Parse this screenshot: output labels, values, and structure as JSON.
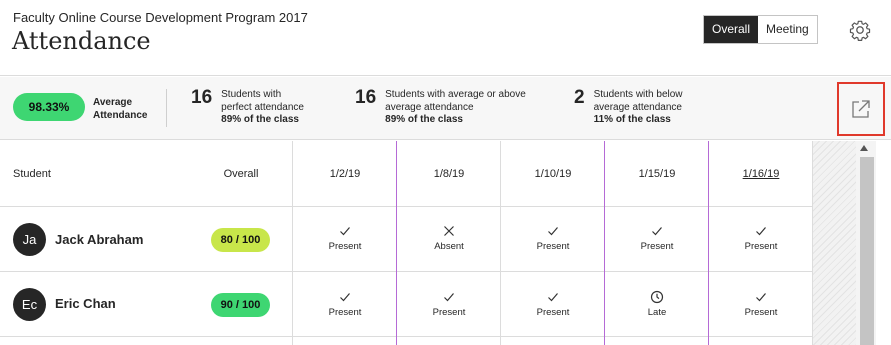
{
  "header": {
    "course_name": "Faculty Online Course Development Program 2017",
    "title": "Attendance",
    "toggle": {
      "overall": "Overall",
      "meeting": "Meeting",
      "active": "overall"
    },
    "settings_icon": "gear-icon"
  },
  "stats": {
    "average_pct": "98.33%",
    "average_label_1": "Average",
    "average_label_2": "Attendance",
    "items": [
      {
        "count": "16",
        "line1": "Students with",
        "line2": "perfect attendance",
        "share": "89% of the class"
      },
      {
        "count": "16",
        "line1": "Students with average or above",
        "line2": "average attendance",
        "share": "89% of the class"
      },
      {
        "count": "2",
        "line1": "Students with below",
        "line2": "average attendance",
        "share": "11% of the class"
      }
    ],
    "popout_icon": "external-link-icon"
  },
  "table": {
    "col_student": "Student",
    "col_overall": "Overall",
    "dates": [
      "1/2/19",
      "1/8/19",
      "1/10/19",
      "1/15/19",
      "1/16/19"
    ],
    "rows": [
      {
        "initials": "Ja",
        "name": "Jack Abraham",
        "grade": "80 / 100",
        "grade_color": "#c8e64a",
        "attendance": [
          {
            "status": "Present",
            "icon": "check-icon"
          },
          {
            "status": "Absent",
            "icon": "x-icon"
          },
          {
            "status": "Present",
            "icon": "check-icon"
          },
          {
            "status": "Present",
            "icon": "check-icon"
          },
          {
            "status": "Present",
            "icon": "check-icon"
          }
        ]
      },
      {
        "initials": "Ec",
        "name": "Eric Chan",
        "grade": "90 / 100",
        "grade_color": "#3ed672",
        "attendance": [
          {
            "status": "Present",
            "icon": "check-icon"
          },
          {
            "status": "Present",
            "icon": "check-icon"
          },
          {
            "status": "Present",
            "icon": "check-icon"
          },
          {
            "status": "Late",
            "icon": "clock-icon"
          },
          {
            "status": "Present",
            "icon": "check-icon"
          }
        ]
      }
    ]
  },
  "colors": {
    "accent_green": "#3ed672",
    "accent_lime": "#c8e64a",
    "highlight_red": "#e0392b",
    "column_purple": "#b56ad6"
  }
}
